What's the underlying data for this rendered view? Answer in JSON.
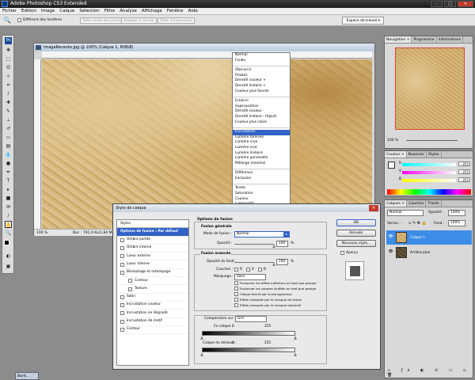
{
  "app": {
    "title": "Adobe Photoshop CS3 Extended"
  },
  "menubar": [
    "Fichier",
    "Edition",
    "Image",
    "Calque",
    "Sélection",
    "Filtre",
    "Analyse",
    "Affichage",
    "Fenêtre",
    "Aide"
  ],
  "options": {
    "windows_label": "Différent des fenêtres",
    "btn_real": "Taille réelle des pixels",
    "btn_fit": "Adapter à l'écran",
    "btn_print": "Taille d'impression",
    "workspace": "Espace de travail ▾"
  },
  "document": {
    "title": "ImageRecente.jpg @ 100% (Calque 1, RVB/8)",
    "zoom": "100 %",
    "doc_info": "Doc : 791,0 Ko/1,84 Mo"
  },
  "blend_modes": [
    [
      "Normal",
      "Fondu"
    ],
    [
      "Obscurcir",
      "Produit",
      "Densité couleur +",
      "Densité linéaire +",
      "Couleur plus foncée"
    ],
    [
      "Eclaircir",
      "Superposition",
      "Densité couleur -",
      "Densité linéaire - (Ajout)",
      "Couleur plus claire"
    ],
    [
      "Incrustation",
      "Lumière tamisée",
      "Lumière crue",
      "Lumière vive",
      "Lumière linéaire",
      "Lumière ponctuelle",
      "Mélange maximal"
    ],
    [
      "Différence",
      "Exclusion"
    ],
    [
      "Teinte",
      "Saturation",
      "Couleur",
      "Luminosité"
    ]
  ],
  "blend_selected": "Incrustation",
  "navigator": {
    "tabs": [
      "Navigation ×",
      "Programme",
      "Informations"
    ],
    "zoom": "100 %"
  },
  "color": {
    "tabs": [
      "Couleur ×",
      "Nuancier",
      "Styles"
    ],
    "r_label": "R",
    "v_label": "V",
    "b_label": "B",
    "r": "255",
    "v": "255",
    "b": "255"
  },
  "layers": {
    "tabs": [
      "Calques ×",
      "Couches",
      "Tracés"
    ],
    "mode": "Normal",
    "opacity_label": "Opacité :",
    "opacity": "100%",
    "lock_label": "Verrou :",
    "fill_label": "Fond :",
    "fill": "100%",
    "items": [
      "Calque 1",
      "Arrière-plan"
    ]
  },
  "dialog": {
    "title": "Style de calque",
    "styles_header": "Styles",
    "styles": [
      {
        "label": "Options de fusion : Par défaut",
        "active": true,
        "cb": false
      },
      {
        "label": "Ombre portée",
        "cb": true
      },
      {
        "label": "Ombre interne",
        "cb": true
      },
      {
        "label": "Lueur externe",
        "cb": true
      },
      {
        "label": "Lueur interne",
        "cb": true
      },
      {
        "label": "Biseautage et estampage",
        "cb": true
      },
      {
        "label": "Contour",
        "cb": true,
        "indent": true
      },
      {
        "label": "Texture",
        "cb": true,
        "indent": true
      },
      {
        "label": "Satin",
        "cb": true
      },
      {
        "label": "Incrustation couleur",
        "cb": true
      },
      {
        "label": "Incrustation en dégradé",
        "cb": true
      },
      {
        "label": "Incrustation de motif",
        "cb": true
      },
      {
        "label": "Contour",
        "cb": true
      }
    ],
    "general_title": "Options de fusion",
    "general_sub": "Fusion générale",
    "mode_label": "Mode de fusion :",
    "mode_value": "Normal",
    "opacity_label": "Opacité :",
    "opacity_value": "100",
    "pct": "%",
    "advanced": "Fusion avancée",
    "fill_label": "Opacité du fond :",
    "fill_value": "100",
    "channels_label": "Couches :",
    "ch_r": "R",
    "ch_v": "V",
    "ch_b": "B",
    "knockout_label": "Masquage :",
    "knockout_value": "Sans",
    "checks": [
      "Fusionner les effets intérieurs en tant que groupe",
      "Fusionner les calques écrêtés en tant que groupe",
      "Calque formé par la transparence",
      "Effets masqués par le masque de fusion",
      "Effets masqués par le masque vectoriel"
    ],
    "blendif_label": "Comparaison sur :",
    "blendif_value": "Gris",
    "this_layer": "Ce calque :",
    "under_layer": "Calque du dessous :",
    "v0": "0",
    "v255": "255",
    "ok": "OK",
    "cancel": "Annuler",
    "new_style": "Nouveau style...",
    "preview": "Aperçu"
  },
  "taskbar": {
    "btn": "Bord..."
  }
}
